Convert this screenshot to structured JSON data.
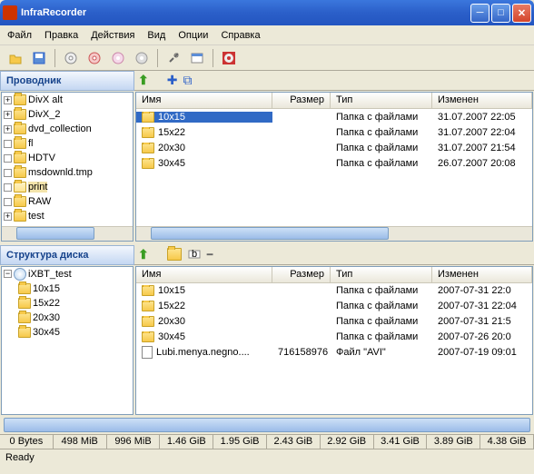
{
  "window": {
    "title": "InfraRecorder"
  },
  "menu": [
    "Файл",
    "Правка",
    "Действия",
    "Вид",
    "Опции",
    "Справка"
  ],
  "sections": {
    "explorer": "Проводник",
    "disc": "Структура диска"
  },
  "tree_explorer": [
    {
      "exp": "+",
      "label": "DivX alt"
    },
    {
      "exp": "+",
      "label": "DivX_2"
    },
    {
      "exp": "+",
      "label": "dvd_collection"
    },
    {
      "exp": "",
      "label": "fl"
    },
    {
      "exp": "",
      "label": "HDTV"
    },
    {
      "exp": "",
      "label": "msdownld.tmp"
    },
    {
      "exp": "",
      "label": "print",
      "sel": true,
      "open": true
    },
    {
      "exp": "",
      "label": "RAW"
    },
    {
      "exp": "+",
      "label": "test"
    }
  ],
  "tree_disc": {
    "root": "iXBT_test",
    "children": [
      "10x15",
      "15x22",
      "20x30",
      "30x45"
    ]
  },
  "cols": {
    "name": "Имя",
    "size": "Размер",
    "type": "Тип",
    "mod": "Изменен"
  },
  "list_top": [
    {
      "name": "10x15",
      "size": "",
      "type": "Папка с файлами",
      "mod": "31.07.2007 22:05",
      "sel": true
    },
    {
      "name": "15x22",
      "size": "",
      "type": "Папка с файлами",
      "mod": "31.07.2007 22:04"
    },
    {
      "name": "20x30",
      "size": "",
      "type": "Папка с файлами",
      "mod": "31.07.2007 21:54"
    },
    {
      "name": "30x45",
      "size": "",
      "type": "Папка с файлами",
      "mod": "26.07.2007 20:08"
    }
  ],
  "list_bottom": [
    {
      "icon": "folder",
      "name": "10x15",
      "size": "",
      "type": "Папка с файлами",
      "mod": "2007-07-31 22:0"
    },
    {
      "icon": "folder",
      "name": "15x22",
      "size": "",
      "type": "Папка с файлами",
      "mod": "2007-07-31 22:04"
    },
    {
      "icon": "folder",
      "name": "20x30",
      "size": "",
      "type": "Папка с файлами",
      "mod": "2007-07-31 21:5"
    },
    {
      "icon": "folder",
      "name": "30x45",
      "size": "",
      "type": "Папка с файлами",
      "mod": "2007-07-26 20:0"
    },
    {
      "icon": "file",
      "name": "Lubi.menya.negno....",
      "size": "716158976",
      "type": "Файл \"AVI\"",
      "mod": "2007-07-19 09:01"
    }
  ],
  "ruler": [
    "0 Bytes",
    "498 MiB",
    "996 MiB",
    "1.46 GiB",
    "1.95 GiB",
    "2.43 GiB",
    "2.92 GiB",
    "3.41 GiB",
    "3.89 GiB",
    "4.38 GiB"
  ],
  "status": "Ready"
}
